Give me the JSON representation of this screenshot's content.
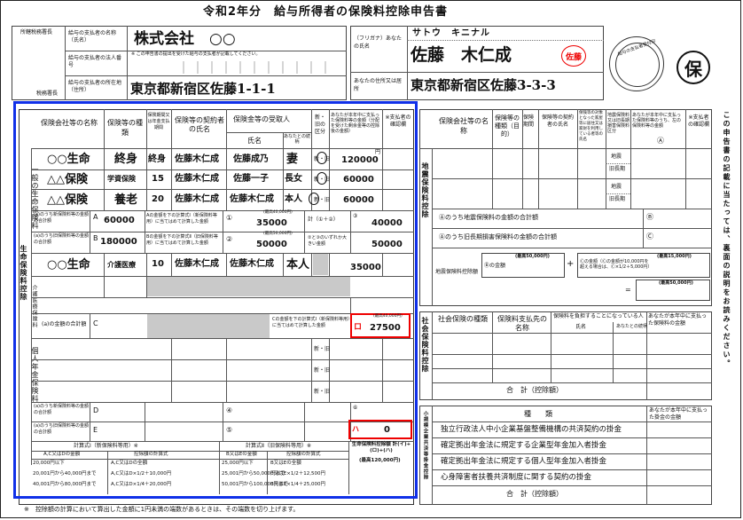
{
  "title": "令和2年分　給与所得者の保険料控除申告書",
  "header": {
    "tax_office_label": "所轄税務署長",
    "tax_office_bottom": "税務署長",
    "employer_name_label": "給与の支払者の名称（氏名）",
    "employer_name": "株式会社　○○",
    "employer_number_label": "給与の支払者の法人番号",
    "employer_number_note": "※ この申告書の提出を受けた給与の支払者が記載してください。",
    "employer_address_label": "給与の支払者の所在地（住所）",
    "employer_address": "東京都新宿区佐藤1-1-1",
    "furigana_label": "（フリガナ）あなたの氏名",
    "furigana": "サトウ　キニナル",
    "name": "佐藤　木仁成",
    "seal": "佐藤",
    "address_label": "あなたの住所又は居所",
    "address": "東京都新宿区佐藤3-3-3",
    "stamp_text": "給与の支払者受付印",
    "badge": "保"
  },
  "life": {
    "section_title": "生命保険料控除",
    "general_label": "一般の生命保険料",
    "care_label": "介護医療保険料",
    "pension_label": "個人年金保険料",
    "col_company": "保険会社等の名称",
    "col_type": "保険等の種類",
    "col_period": "保険期間又は年金支払期間",
    "col_contractor": "保険等の契約者の氏名",
    "col_recipient": "保険金等の受取人",
    "col_recipient_name": "氏名",
    "col_relation": "あなたとの続柄",
    "col_newold": "新・旧の区分",
    "col_amount": "あなたが本年中に支払った保険料等の金額（分配を受けた剰余金等の控除後の金額）",
    "col_confirm": "※支払者の確認欄",
    "unit_yen": "円",
    "new_old": "新・旧",
    "rows": [
      {
        "company": "○○生命",
        "type": "終身",
        "period": "終身",
        "contractor": "佐藤木仁成",
        "recipient": "佐藤成乃",
        "relation": "妻",
        "amount": "120000"
      },
      {
        "company": "△△保険",
        "type": "学資保険",
        "period": "15",
        "contractor": "佐藤木仁成",
        "recipient": "佐藤一子",
        "relation": "長女",
        "amount": "60000"
      },
      {
        "company": "△△保険",
        "type": "養老",
        "period": "20",
        "contractor": "佐藤木仁成",
        "recipient": "佐藤木仁成",
        "relation": "本人",
        "amount": "60000"
      }
    ],
    "sum_a_label": "(a)のうち新保険料等の金額の合計額",
    "sum_a": "60000",
    "sum_b_label": "(a)のうち旧保険料等の金額の合計額",
    "sum_b": "180000",
    "calc1_label": "Aの金額を下の計算式Ⅰ（新保険料等用）に当てはめて計算した金額",
    "calc1": "35000",
    "calc2_label": "Bの金額を下の計算式Ⅱ（旧保険料等用）に当てはめて計算した金額",
    "calc2": "50000",
    "max_40000": "(最高40,000円)",
    "max_50000": "(最高50,000円)",
    "total12_label": "計（①＋②）",
    "total12": "40000",
    "bigger_label": "②と③のいずれか大きい金額",
    "bigger": "50000",
    "care_row": {
      "company": "○○生命",
      "type": "介護医療",
      "period": "10",
      "contractor": "佐藤木仁成",
      "recipient": "佐藤木仁成",
      "relation": "本人",
      "amount": "35000"
    },
    "care_calc_label": "Cの金額を下の計算式Ⅰ（新保険料等用）に当てはめて計算した金額",
    "sum_c_label": "(a)の金額の合計額",
    "ro_value": "27500",
    "ro_mark": "ロ",
    "sum_d_label": "(a)のうち新保険料等の金額の合計額",
    "sum_e_label": "(a)のうち旧保険料等の金額の合計額",
    "ha_value": "0",
    "ha_mark": "ハ",
    "life_total_label": "生命保険料控除額 計(イ)+(ロ)+(ハ)",
    "life_total_max": "(最高120,000円)",
    "formula1_title": "計算式Ⅰ（新保険料等用）※",
    "formula2_title": "計算式Ⅱ（旧保険料等用）※",
    "formula_col1": "A,C又はDの金額",
    "formula_col2": "控除額の計算式",
    "formula_col3": "B又はEの金額",
    "formula_col4": "控除額の計算式",
    "formula1_rows": [
      [
        "20,000円以下",
        "A,C又はDの全額"
      ],
      [
        "20,001円から40,000円まで",
        "A,C又はD×1/2＋10,000円"
      ],
      [
        "40,001円から80,000円まで",
        "A,C又はD×1/4＋20,000円"
      ]
    ],
    "formula2_rows": [
      [
        "25,000円以下",
        "B又はEの全額"
      ],
      [
        "25,001円から50,000円まで",
        "B又はE×1/2＋12,500円"
      ],
      [
        "50,001円から100,000円まで",
        "B又はE×1/4＋25,000円"
      ]
    ]
  },
  "quake": {
    "section_title": "地震保険料控除",
    "col_company": "保険会社等の名称",
    "col_type": "保険等の種類（目的）",
    "col_period": "保険期間",
    "col_contractor": "保険等の契約者の氏名",
    "col_target": "保険等の対象となった家屋等に居住又は家財を利用している者等の氏名",
    "col_kind": "地震保険料又は旧長期損害保険料区分",
    "col_amount": "あなたが本年中に支払った保険料等のうち、左の保険料等の金額",
    "col_confirm": "※支払者の確認欄",
    "kind_quake": "地震",
    "kind_old": "旧長期",
    "sum_a_label": "Ⓐのうち地震保険料の金額の合計額",
    "sum_b_label": "Ⓐのうち旧長期損害保険料の金額の合計額",
    "deduct_label": "地震保険料控除額",
    "b_amount_label": "Ⓑの金額",
    "c_formula": "Ⓒの金額（Ⓒの金額が10,000円を超える場合は、Ⓒ×1/2＋5,000円）",
    "max_50000": "(最高50,000円)",
    "max_15000": "(最高15,000円)",
    "mark_a": "Ⓐ",
    "mark_b": "Ⓑ",
    "mark_c": "Ⓒ"
  },
  "social": {
    "section_title": "社会保険料控除",
    "col_type": "社会保険の種類",
    "col_payee": "保険料支払先の名称",
    "col_payer": "保険料を負担することになっている人",
    "col_payer_name": "氏名",
    "col_relation": "あなたとの続柄",
    "col_amount": "あなたが本年中に支払った保険料の金額",
    "total": "合　計（控除額）"
  },
  "small": {
    "section_title": "小規模企業共済等掛金控除",
    "col_kind": "種　　類",
    "col_amount": "あなたが本年中に支払った掛金の金額",
    "items": [
      "独立行政法人中小企業基盤整備機構の共済契約の掛金",
      "確定拠出年金法に規定する企業型年金加入者掛金",
      "確定拠出年金法に規定する個人型年金加入者掛金",
      "心身障害者扶養共済制度に関する契約の掛金"
    ],
    "total": "合　計（控除額）"
  },
  "side_note": "この申告書の記載に当たっては、裏面の説明をお読みください。",
  "footnote": "※　控除額の計算において算出した金額に1円未満の端数があるときは、その端数を切り上げます。"
}
